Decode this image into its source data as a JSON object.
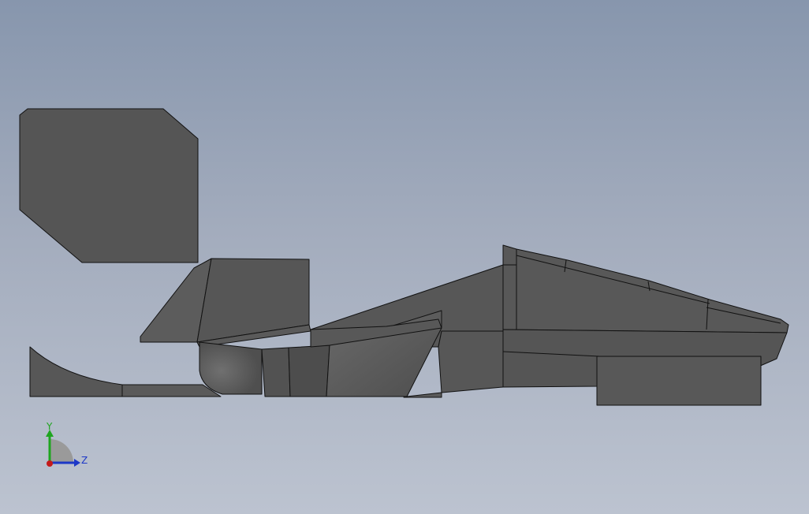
{
  "viewport": {
    "background_top": "#8796ad",
    "background_bottom": "#bcc3d0",
    "model_face_color": "#565656",
    "model_edge_color": "#111111"
  },
  "triad": {
    "y_label": "Y",
    "z_label": "Z",
    "y_color": "#1fa51f",
    "z_color": "#1d38c7",
    "x_color": "#c41a1a"
  }
}
